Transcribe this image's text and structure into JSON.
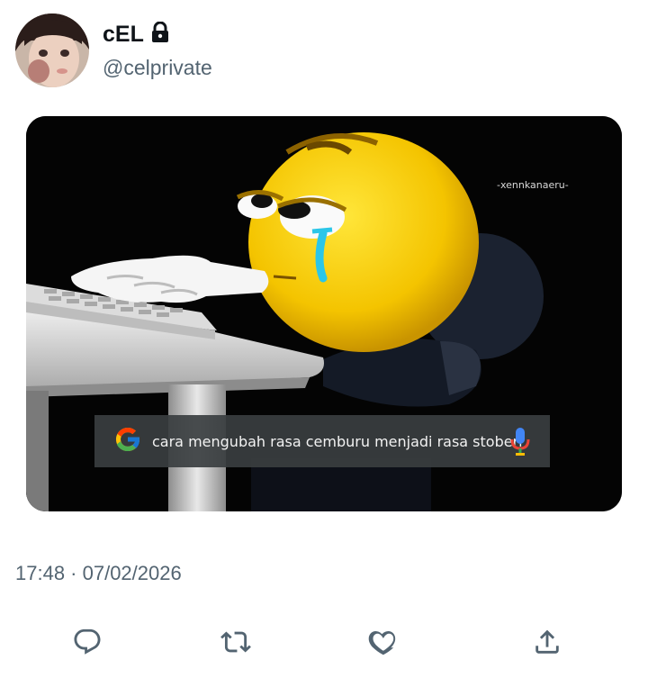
{
  "author": {
    "display_name": "cEL",
    "handle": "@celprivate",
    "protected_icon": "lock-icon"
  },
  "media": {
    "watermark": "-xennkanaeru-",
    "search_query": "cara mengubah rasa cemburu menjadi rasa stoberi",
    "search_logo": "google-g-icon",
    "mic_icon": "microphone-icon"
  },
  "timestamp": "17:48 · 07/02/2026",
  "actions": [
    {
      "name": "reply",
      "icon": "reply-icon"
    },
    {
      "name": "retweet",
      "icon": "retweet-icon"
    },
    {
      "name": "like",
      "icon": "heart-icon"
    },
    {
      "name": "share",
      "icon": "share-icon"
    }
  ],
  "colors": {
    "text_primary": "#0f1419",
    "text_secondary": "#536471",
    "icon_gray": "#536471"
  }
}
